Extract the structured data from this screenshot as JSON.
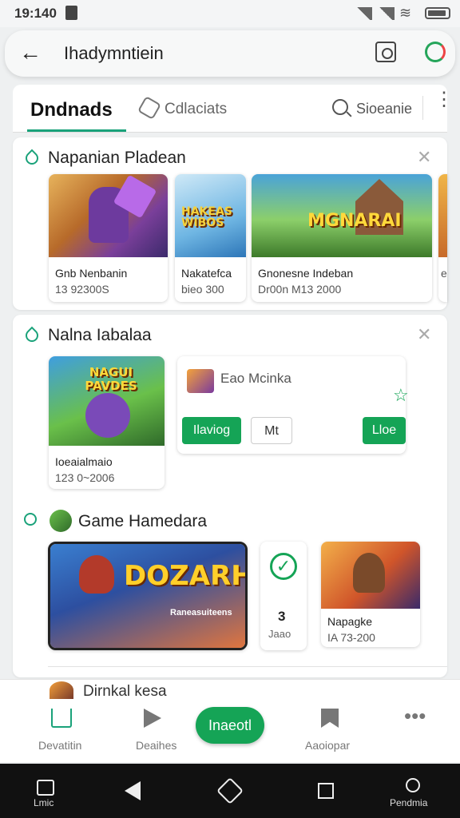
{
  "status_bar": {
    "time": "19:140"
  },
  "header": {
    "title": "Ihadymntiein"
  },
  "tabs": {
    "active": "Dndnads",
    "second": "Cdlaciats",
    "search_label": "Sioeanie"
  },
  "section1": {
    "title": "Napanian Pladean",
    "tiles": [
      {
        "name": "Gnb Nenbanin",
        "sub": "13 92300S"
      },
      {
        "name": "Nakatefca",
        "sub": "bieo 300",
        "art_text": "HAKEAS WIBOS"
      },
      {
        "name": "Gnonesne Indeban",
        "sub": "Dr00n  M13 2000",
        "art_text": "MGNARAI"
      },
      {
        "name": "",
        "sub": "e"
      }
    ]
  },
  "section2": {
    "title": "Nalna Iabalaa",
    "tile": {
      "name": "Ioeaialmaio",
      "sub": "123 0~2006",
      "art_text": "NAGUI PAVDES"
    },
    "detail": {
      "label": "Eao Mcinka",
      "btn1": "Ilaviog",
      "btn2": "Mt",
      "btn3": "Lloe"
    }
  },
  "section3": {
    "title": "Game Hamedara",
    "big_tile": {
      "art_text": "DOZARH",
      "caption": "Raneasuiteens"
    },
    "small_card": {
      "num": "3",
      "sub": "Jaao"
    },
    "tile": {
      "name": "Napagke",
      "sub": "IA 73-200"
    }
  },
  "peek_row": {
    "label": "Dirnkal kesa"
  },
  "bottom_nav": {
    "items": [
      {
        "label": "Devatitin"
      },
      {
        "label": "Deaihes"
      },
      {
        "label": "Inaeotl"
      },
      {
        "label": "Aaoiopar"
      }
    ]
  },
  "system_nav": {
    "left": "Lmic",
    "right": "Pendmia"
  }
}
